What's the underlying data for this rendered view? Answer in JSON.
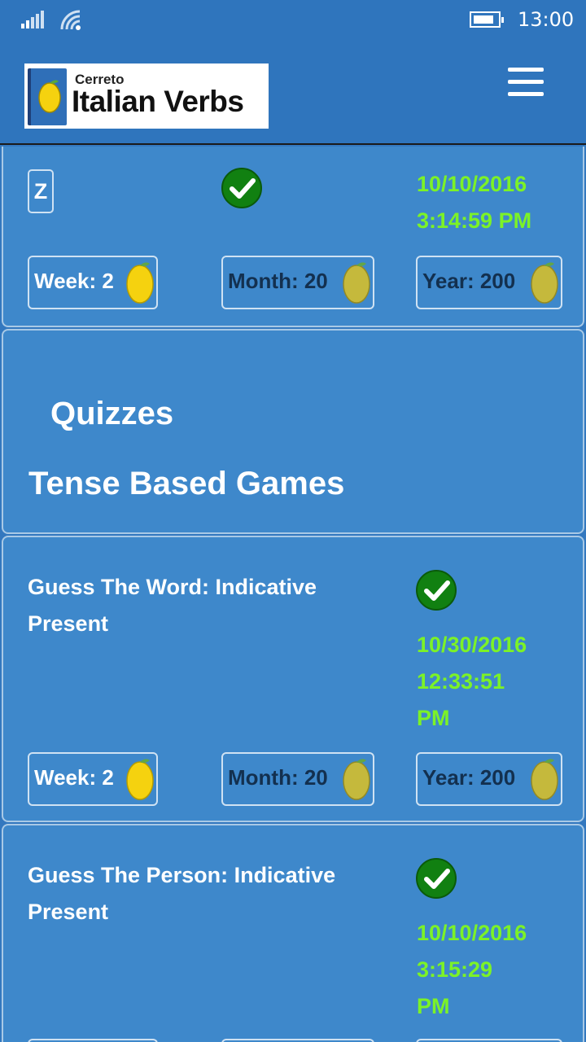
{
  "status": {
    "time": "13:00",
    "icons": [
      "signal-icon",
      "wifi-icon",
      "battery-icon"
    ]
  },
  "header": {
    "logo_small": "Cerreto",
    "logo_big": "Italian Verbs",
    "menu_icon": "hamburger-menu-icon"
  },
  "cards": [
    {
      "letter": "Z",
      "date": "10/10/2016",
      "time": "3:14:59 PM",
      "week": "Week: 2",
      "month": "Month: 20",
      "year": "Year: 200"
    },
    {
      "heading_quizzes": "Quizzes",
      "heading_tense": "Tense Based Games"
    },
    {
      "title_line1": "Guess The Word: Indicative",
      "title_line2": "Present",
      "date": "10/30/2016",
      "time_line1": "12:33:51",
      "time_line2": "PM",
      "week": "Week: 2",
      "month": "Month: 20",
      "year": "Year: 200"
    },
    {
      "title_line1": "Guess The Person: Indicative",
      "title_line2": "Present",
      "date": "10/10/2016",
      "time_line1": "3:15:29",
      "time_line2": "PM"
    }
  ],
  "colors": {
    "background": "#3378bf",
    "card": "#3e88cb",
    "date_green": "#7cf227",
    "check_green": "#118011",
    "week_text": "#ffffff",
    "month_year_text": "#13304f",
    "lemon_bright": "#f5d20f",
    "lemon_dull": "#c5b93c"
  }
}
